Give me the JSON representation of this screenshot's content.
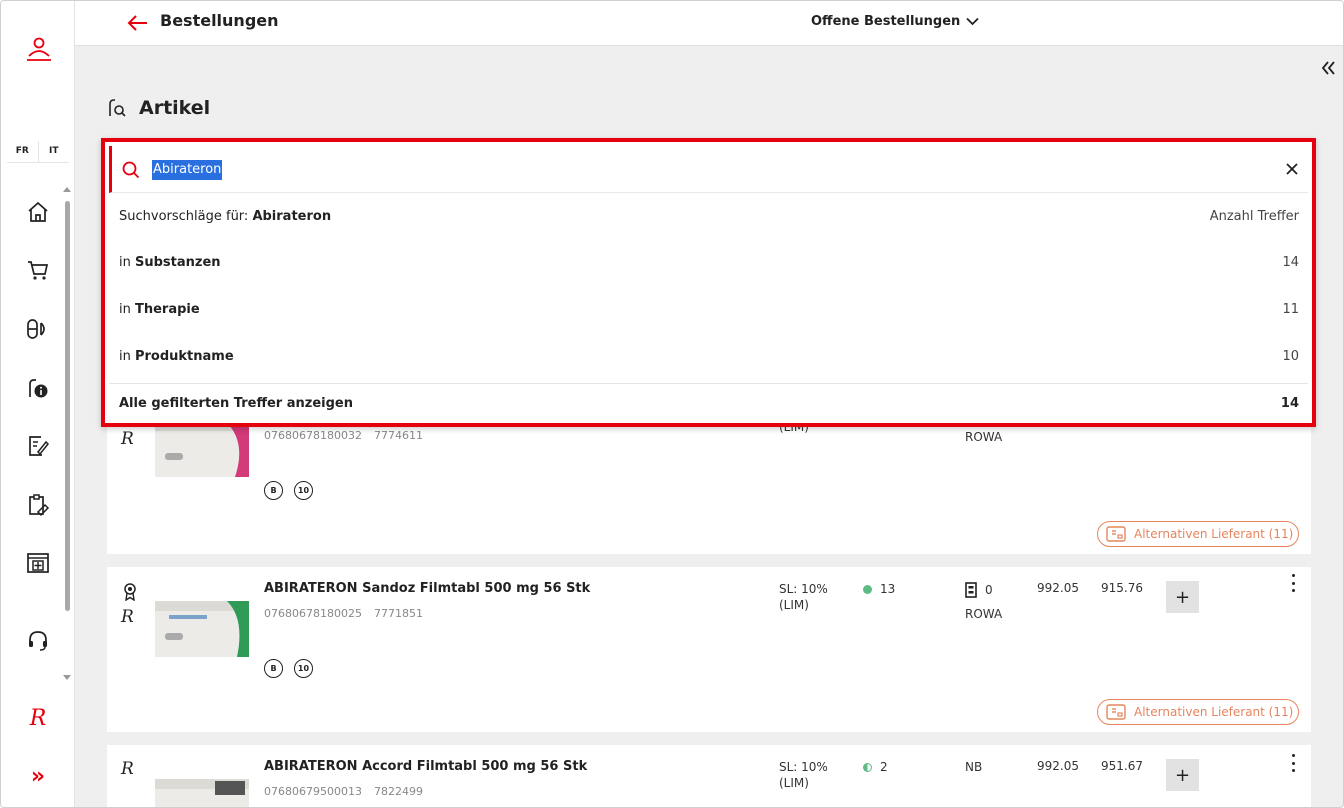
{
  "sidebar": {
    "langs": [
      "FR",
      "IT"
    ],
    "items": [
      {
        "name": "home-icon"
      },
      {
        "name": "cart-icon"
      },
      {
        "name": "pills-icon"
      },
      {
        "name": "info-icon"
      },
      {
        "name": "edit-document-icon"
      },
      {
        "name": "clipboard-icon"
      },
      {
        "name": "pharmacy-icon"
      },
      {
        "name": "headset-icon"
      },
      {
        "name": "brand-r-icon"
      },
      {
        "name": "expand-icon"
      }
    ],
    "brand_letter": "R",
    "expand_glyph": "»"
  },
  "header": {
    "title": "Bestellungen",
    "order_filter": "Offene Bestellungen"
  },
  "main": {
    "title": "Artikel"
  },
  "search": {
    "value": "Abirateron",
    "suggestions_prefix": "Suchvorschläge für: ",
    "suggestions_term": "Abirateron",
    "count_header": "Anzahl Treffer",
    "items": [
      {
        "prefix": "in ",
        "label": "Substanzen",
        "count": "14"
      },
      {
        "prefix": "in ",
        "label": "Therapie",
        "count": "11"
      },
      {
        "prefix": "in ",
        "label": "Produktname",
        "count": "10"
      }
    ],
    "show_all_label": "Alle gefilterten Treffer anzeigen",
    "show_all_count": "14"
  },
  "products": [
    {
      "name": "",
      "ean": "07680678180032",
      "pharmacode": "7774611",
      "sl_line1": "",
      "sl_line2": "(LIM)",
      "supplier": "ROWA",
      "badges": [
        "B",
        "10"
      ],
      "alt_label": "Alternativen Lieferant (11)"
    },
    {
      "name": "ABIRATERON Sandoz Filmtabl 500 mg 56 Stk",
      "ean": "07680678180025",
      "pharmacode": "7771851",
      "sl_line1": "SL: 10%",
      "sl_line2": "(LIM)",
      "stock": "13",
      "stock_store": "0",
      "supplier": "ROWA",
      "price1": "992.05",
      "price2": "915.76",
      "badges": [
        "B",
        "10"
      ],
      "alt_label": "Alternativen Lieferant (11)"
    },
    {
      "name": "ABIRATERON Accord Filmtabl 500 mg 56 Stk",
      "ean": "07680679500013",
      "pharmacode": "7822499",
      "sl_line1": "SL: 10%",
      "sl_line2": "(LIM)",
      "stock": "2",
      "supplier": "NB",
      "price1": "992.05",
      "price2": "951.67"
    }
  ],
  "add_label": "+",
  "colors": {
    "accent": "#e6000d",
    "alt": "#e6855f",
    "stock_green": "#5dbb84"
  }
}
